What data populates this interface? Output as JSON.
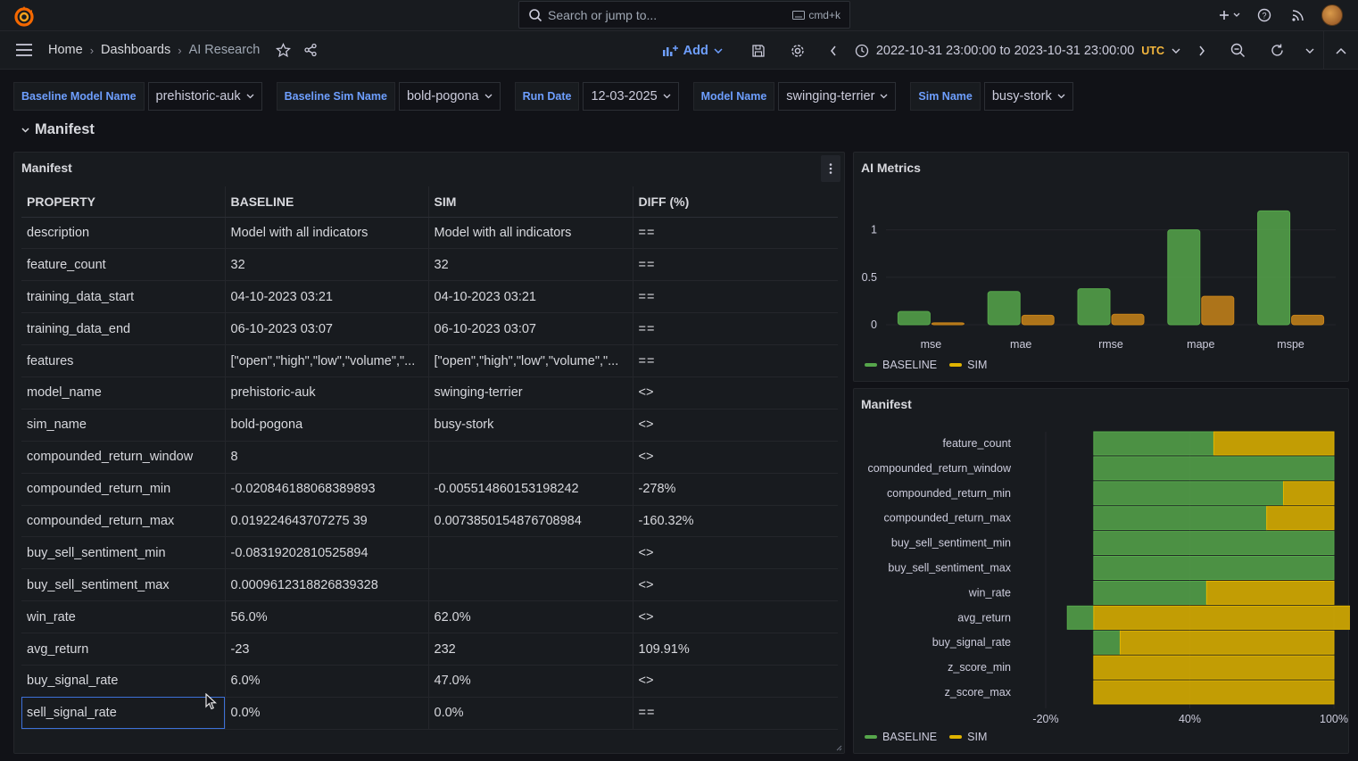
{
  "topbar": {
    "search_placeholder": "Search or jump to...",
    "search_shortcut": "cmd+k"
  },
  "navbar": {
    "breadcrumbs": [
      "Home",
      "Dashboards",
      "AI Research"
    ],
    "add_label": "Add",
    "time_range": "2022-10-31 23:00:00 to 2023-10-31 23:00:00",
    "timezone": "UTC"
  },
  "variables": [
    {
      "label": "Baseline Model Name",
      "value": "prehistoric-auk"
    },
    {
      "label": "Baseline Sim Name",
      "value": "bold-pogona"
    },
    {
      "label": "Run Date",
      "value": "12-03-2025"
    },
    {
      "label": "Model Name",
      "value": "swinging-terrier"
    },
    {
      "label": "Sim Name",
      "value": "busy-stork"
    }
  ],
  "row": {
    "title": "Manifest"
  },
  "manifest_panel": {
    "title": "Manifest",
    "columns": [
      "PROPERTY",
      "BASELINE",
      "SIM",
      "DIFF (%)"
    ],
    "rows": [
      [
        "description",
        "Model with all indicators",
        "Model with all indicators",
        "=="
      ],
      [
        "feature_count",
        "32",
        "32",
        "=="
      ],
      [
        "training_data_start",
        "04-10-2023 03:21",
        "04-10-2023 03:21",
        "=="
      ],
      [
        "training_data_end",
        "06-10-2023 03:07",
        "06-10-2023 03:07",
        "=="
      ],
      [
        "features",
        "[\"open\",\"high\",\"low\",\"volume\",\"...",
        "[\"open\",\"high\",\"low\",\"volume\",\"...",
        "=="
      ],
      [
        "model_name",
        "prehistoric-auk",
        "swinging-terrier",
        "<>"
      ],
      [
        "sim_name",
        "bold-pogona",
        "busy-stork",
        "<>"
      ],
      [
        "compounded_return_window",
        "8",
        "",
        "<>"
      ],
      [
        "compounded_return_min",
        "-0.020846188068389893",
        "-0.005514860153198242",
        "-278%"
      ],
      [
        "compounded_return_max",
        "0.019224643707275 39",
        "0.0073850154876708984",
        "-160.32%"
      ],
      [
        "buy_sell_sentiment_min",
        "-0.08319202810525894",
        "",
        "<>"
      ],
      [
        "buy_sell_sentiment_max",
        "0.0009612318826839328",
        "",
        "<>"
      ],
      [
        "win_rate",
        "56.0%",
        "62.0%",
        "<>"
      ],
      [
        "avg_return",
        "-23",
        "232",
        "109.91%"
      ],
      [
        "buy_signal_rate",
        "6.0%",
        "47.0%",
        "<>"
      ],
      [
        "sell_signal_rate",
        "0.0%",
        "0.0%",
        "=="
      ]
    ]
  },
  "ai_metrics_panel": {
    "title": "AI Metrics",
    "legend": [
      "BASELINE",
      "SIM"
    ]
  },
  "manifest_chart_panel": {
    "title": "Manifest",
    "legend": [
      "BASELINE",
      "SIM"
    ]
  },
  "colors": {
    "baseline": "#56a64b",
    "sim_metrics": "#c8841a",
    "sim_manifest": "#e0b400",
    "accent": "#6e9fff",
    "diff_red": "#f2495c",
    "diff_green": "#73bf69"
  },
  "chart_data": [
    {
      "type": "bar",
      "title": "AI Metrics",
      "categories": [
        "mse",
        "mae",
        "rmse",
        "mape",
        "mspe"
      ],
      "series": [
        {
          "name": "BASELINE",
          "values": [
            0.14,
            0.35,
            0.38,
            1.0,
            1.2
          ]
        },
        {
          "name": "SIM",
          "values": [
            0.02,
            0.1,
            0.11,
            0.3,
            0.1
          ]
        }
      ],
      "yticks": [
        "0",
        "0.5",
        "1"
      ],
      "ylim": [
        0,
        1.25
      ],
      "grid": true,
      "legend_position": "bottom-left"
    },
    {
      "type": "bar",
      "orientation": "horizontal",
      "stacked": true,
      "title": "Manifest",
      "categories": [
        "feature_count",
        "compounded_return_window",
        "compounded_return_min",
        "compounded_return_max",
        "buy_sell_sentiment_min",
        "buy_sell_sentiment_max",
        "win_rate",
        "avg_return",
        "buy_signal_rate",
        "z_score_min",
        "z_score_max"
      ],
      "series": [
        {
          "name": "BASELINE",
          "values": [
            50,
            100,
            79,
            72,
            100,
            100,
            47,
            -11,
            11,
            0,
            0
          ]
        },
        {
          "name": "SIM",
          "values": [
            50,
            0,
            21,
            28,
            0,
            0,
            53,
            111,
            89,
            100,
            100
          ]
        }
      ],
      "xticks": [
        "-20%",
        "40%",
        "100%"
      ],
      "xlim": [
        -20,
        100
      ],
      "legend_position": "bottom-left"
    }
  ]
}
